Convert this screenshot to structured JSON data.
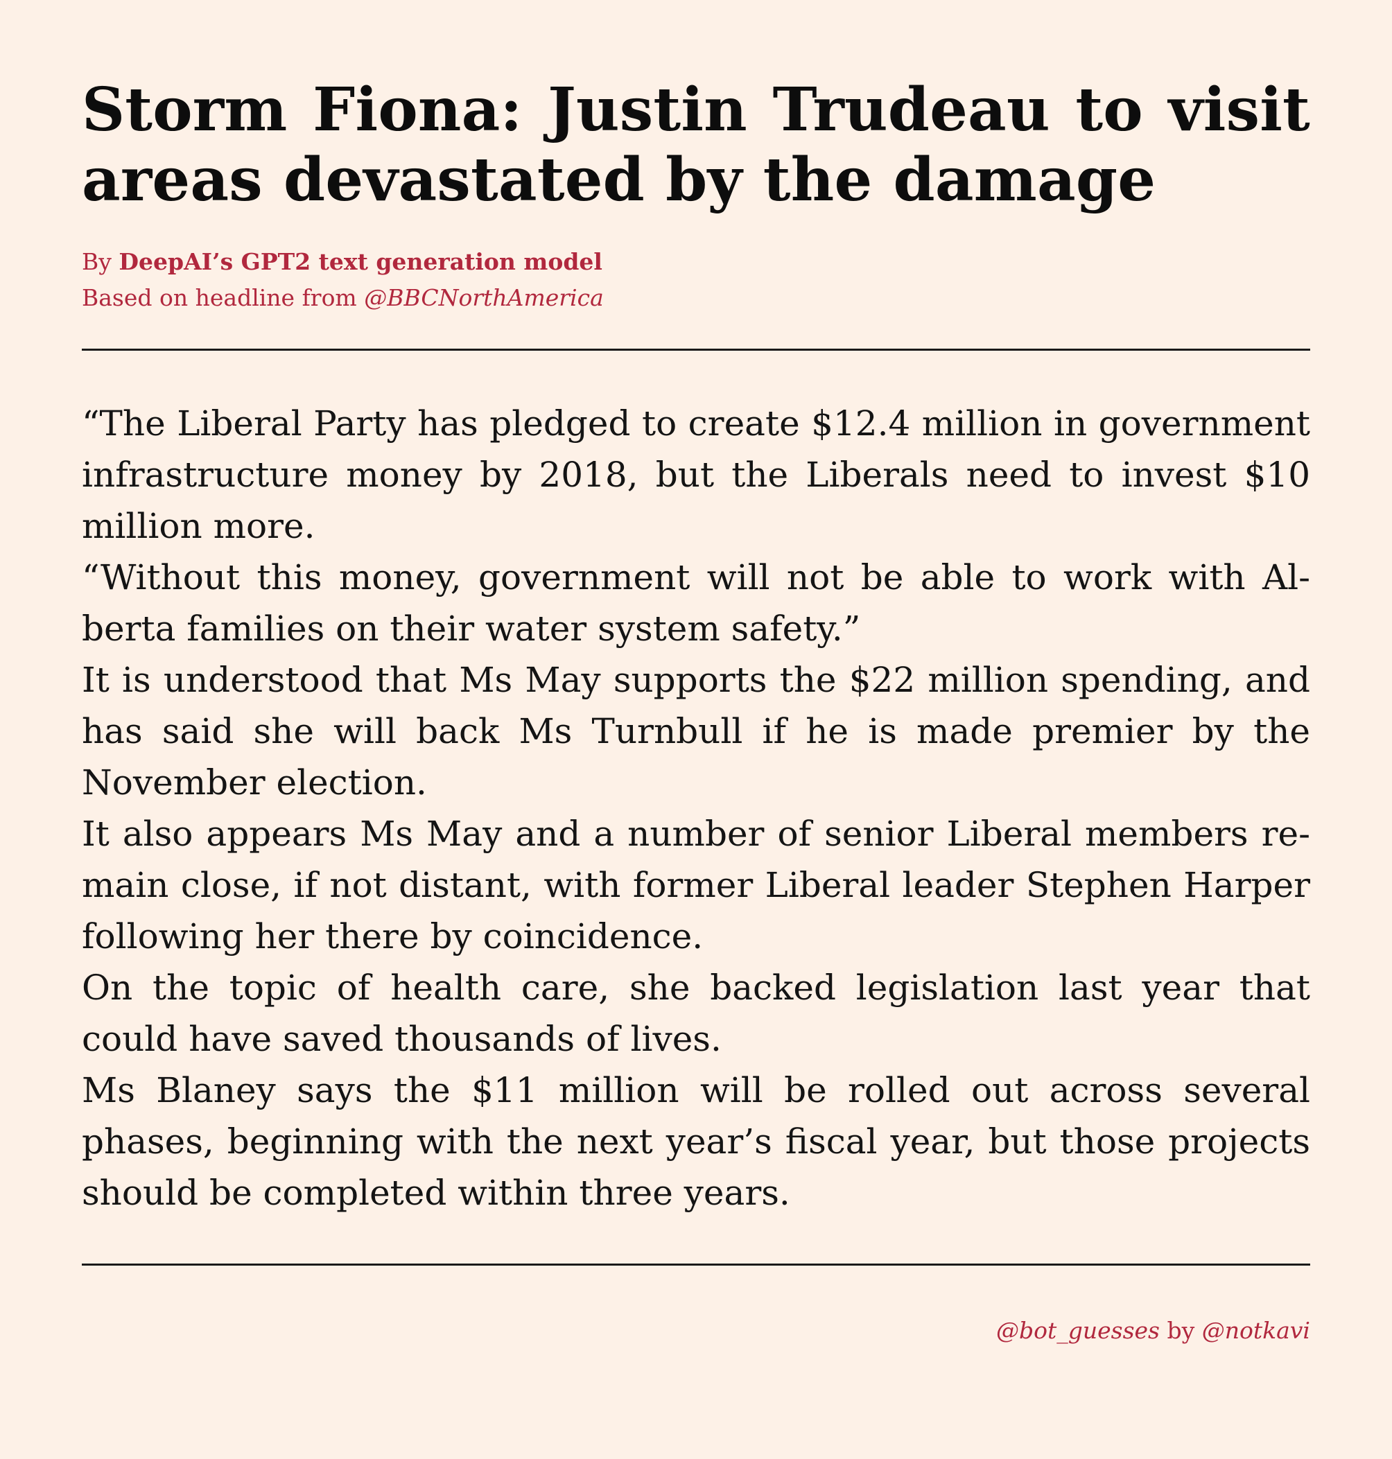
{
  "headline": "Storm Fiona: Justin Trudeau to visit areas devastated by the damage",
  "byline": {
    "by_prefix": "By ",
    "author": "DeepAI’s GPT2 text generation model",
    "based_prefix": "Based on headline from ",
    "source_handle": "@BBCNorthAmerica"
  },
  "article": {
    "paragraphs": [
      "“The Liberal Party has pledged to create $12.4 million in government infrastructure money by 2018, but the Liberals need to invest $10 million more.",
      "“Without this money, government will not be able to work with Al­berta families on their water system safety.”",
      "It is understood that Ms May supports the $22 million spending, and has said she will back Ms Turnbull if he is made premier by the November election.",
      "It also appears Ms May and a number of senior Liberal members re­main close, if not distant, with former Liberal leader Stephen Harper following her there by coincidence.",
      "On the topic of health care, she backed legislation last year that could have saved thousands of lives.",
      "Ms Blaney says the $11 million will be rolled out across several phases, beginning with the next year’s fiscal year, but those projects should be completed within three years."
    ]
  },
  "footer": {
    "bot_handle": "@bot_guesses",
    "by_word": " by ",
    "creator_handle": "@notkavi"
  },
  "colors": {
    "background": "#fdf1e7",
    "accent": "#b1283e",
    "text": "#111111"
  }
}
